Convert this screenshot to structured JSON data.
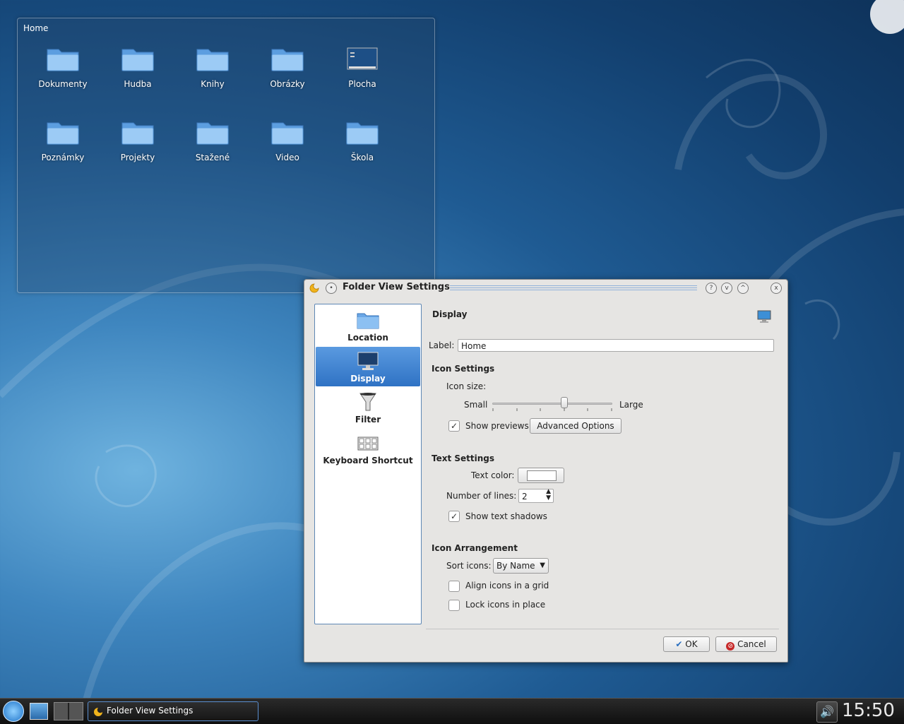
{
  "folderview": {
    "title": "Home",
    "items": [
      {
        "label": "Dokumenty",
        "icon": "folder-icon"
      },
      {
        "label": "Hudba",
        "icon": "folder-icon"
      },
      {
        "label": "Knihy",
        "icon": "folder-icon"
      },
      {
        "label": "Obrázky",
        "icon": "folder-icon"
      },
      {
        "label": "Plocha",
        "icon": "desktop-icon"
      },
      {
        "label": "Poznámky",
        "icon": "folder-icon"
      },
      {
        "label": "Projekty",
        "icon": "folder-icon"
      },
      {
        "label": "Stažené",
        "icon": "folder-icon"
      },
      {
        "label": "Video",
        "icon": "folder-icon"
      },
      {
        "label": "Škola",
        "icon": "folder-icon"
      }
    ]
  },
  "dialog": {
    "title": "Folder View Settings",
    "titlebar_buttons": {
      "help": "?",
      "minimize": "v",
      "maximize": "^",
      "close": "x"
    },
    "sidebar": [
      {
        "label": "Location",
        "icon": "folder-icon",
        "selected": false
      },
      {
        "label": "Display",
        "icon": "monitor-icon",
        "selected": true
      },
      {
        "label": "Filter",
        "icon": "funnel-icon",
        "selected": false
      },
      {
        "label": "Keyboard Shortcut",
        "icon": "keyboard-icon",
        "selected": false
      }
    ],
    "page": {
      "heading": "Display",
      "label_field": {
        "label": "Label:",
        "value": "Home"
      },
      "icon_settings": {
        "heading": "Icon Settings",
        "icon_size_label": "Icon size:",
        "slider_min_label": "Small",
        "slider_max_label": "Large",
        "slider_value_fraction": 0.6,
        "show_previews": {
          "label": "Show previews",
          "checked": true
        },
        "advanced_button": "Advanced Options"
      },
      "text_settings": {
        "heading": "Text Settings",
        "text_color_label": "Text color:",
        "text_color_value": "#ffffff",
        "lines_label": "Number of lines:",
        "lines_value": "2",
        "show_shadows": {
          "label": "Show text shadows",
          "checked": true
        }
      },
      "arrangement": {
        "heading": "Icon Arrangement",
        "sort_label": "Sort icons:",
        "sort_value": "By Name",
        "align_grid": {
          "label": "Align icons in a grid",
          "checked": false
        },
        "lock_place": {
          "label": "Lock icons in place",
          "checked": false
        }
      }
    },
    "buttons": {
      "ok": "OK",
      "cancel": "Cancel"
    }
  },
  "taskbar": {
    "task_label": "Folder View Settings",
    "clock": "15:50"
  },
  "colors": {
    "accent": "#2f72c4",
    "desktop_dark": "#0e325a",
    "desktop_light": "#6fb3df"
  }
}
